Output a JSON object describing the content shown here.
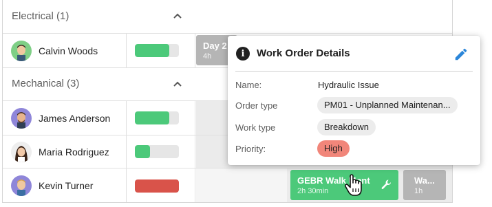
{
  "groups": [
    {
      "label": "Electrical (1)"
    },
    {
      "label": "Mechanical (3)"
    }
  ],
  "technicians": [
    {
      "name": "Calvin Woods",
      "utilization": 0.78,
      "bar_color": "#4cc97a"
    },
    {
      "name": "James Anderson",
      "utilization": 0.78,
      "bar_color": "#4cc97a"
    },
    {
      "name": "Maria Rodriguez",
      "utilization": 0.35,
      "bar_color": "#4cc97a"
    },
    {
      "name": "Kevin Turner",
      "utilization": 1.0,
      "bar_color": "#d9534a"
    }
  ],
  "events": {
    "day": {
      "title": "Day 2",
      "subtitle": "4h",
      "color": "#b5b5b5"
    },
    "gebr": {
      "title": "GEBR Walk Mont",
      "subtitle": "2h 30min",
      "color": "#4cc97a"
    },
    "wa": {
      "title": "Wa...",
      "subtitle": "1h",
      "color": "#b5b5b5"
    }
  },
  "popup": {
    "title": "Work Order Details",
    "fields": {
      "name": {
        "label": "Name:",
        "value": "Hydraulic Issue"
      },
      "order_type": {
        "label": "Order type",
        "value": "PM01 - Unplanned Maintenan..."
      },
      "work_type": {
        "label": "Work type",
        "value": "Breakdown"
      },
      "priority": {
        "label": "Priority:",
        "value": "High"
      }
    }
  },
  "colors": {
    "accent_blue": "#2b86d9",
    "priority_high": "#f1867a",
    "available": "#4cc97a",
    "overloaded": "#d9534a"
  }
}
